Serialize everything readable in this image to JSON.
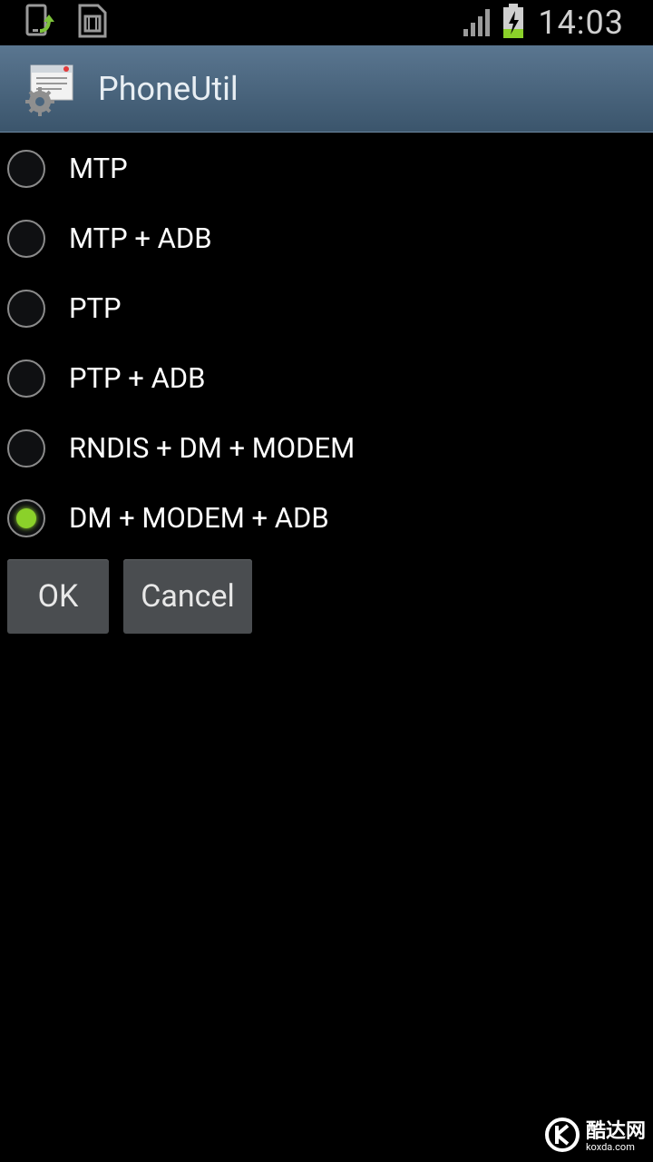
{
  "status_bar": {
    "time": "14:03",
    "icons": [
      "phone-upload-icon",
      "sim-card-icon",
      "signal-icon",
      "battery-charging-icon"
    ]
  },
  "action_bar": {
    "title": "PhoneUtil",
    "icon": "app-settings-icon"
  },
  "options": [
    {
      "label": "MTP",
      "checked": false
    },
    {
      "label": "MTP + ADB",
      "checked": false
    },
    {
      "label": "PTP",
      "checked": false
    },
    {
      "label": "PTP + ADB",
      "checked": false
    },
    {
      "label": "RNDIS + DM + MODEM",
      "checked": false
    },
    {
      "label": "DM + MODEM + ADB",
      "checked": true
    }
  ],
  "buttons": {
    "ok_label": "OK",
    "cancel_label": "Cancel"
  },
  "watermark": {
    "main": "酷达网",
    "sub": "koxda.com"
  },
  "colors": {
    "accent_green": "#8bd12a",
    "action_bar": "#4a657e"
  }
}
